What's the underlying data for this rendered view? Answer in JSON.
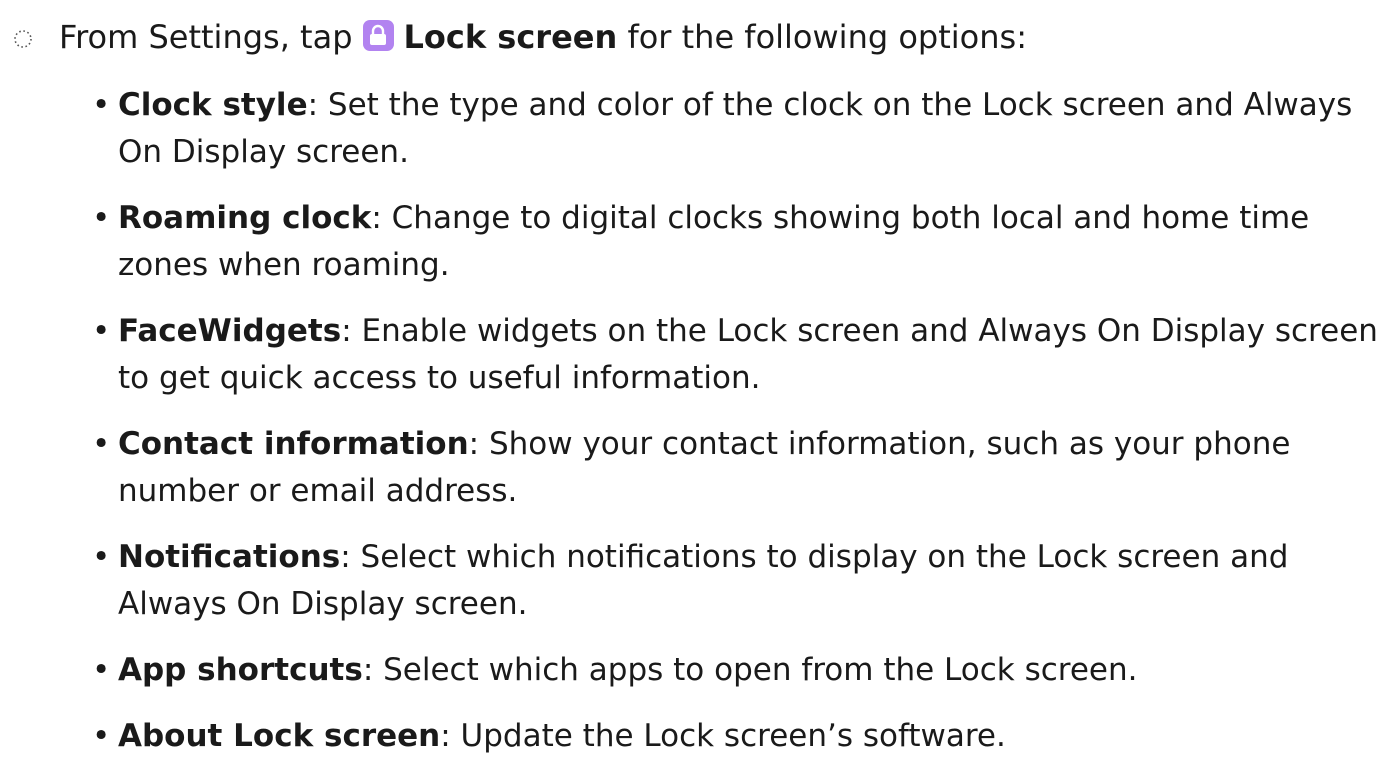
{
  "intro": {
    "prefix": "From Settings, tap",
    "menu_name": "Lock screen",
    "suffix": "for the following options:",
    "step_icon": "dotted-circle-icon",
    "menu_icon": "lock-icon",
    "menu_icon_color": "#b283f0"
  },
  "bullet_char": "•",
  "options": [
    {
      "term": "Clock style",
      "separator": ":",
      "description": " Set the type and color of the clock on the Lock screen and Always On Display screen."
    },
    {
      "term": "Roaming clock",
      "separator": ":",
      "description": " Change to digital clocks showing both local and home time zones when roaming."
    },
    {
      "term": "FaceWidgets",
      "separator": ":",
      "description": " Enable widgets on the Lock screen and Always On Display screen to get quick access to useful information."
    },
    {
      "term": "Contact information",
      "separator": ":",
      "description": " Show your contact information, such as your phone number or email address."
    },
    {
      "term": "Notifications",
      "separator": ":",
      "description": " Select which notifications to display on the Lock screen and Always On Display screen."
    },
    {
      "term": "App shortcuts",
      "separator": ":",
      "description": " Select which apps to open from the Lock screen."
    },
    {
      "term": "About Lock screen",
      "separator": ":",
      "description": " Update the Lock screen’s software."
    }
  ]
}
